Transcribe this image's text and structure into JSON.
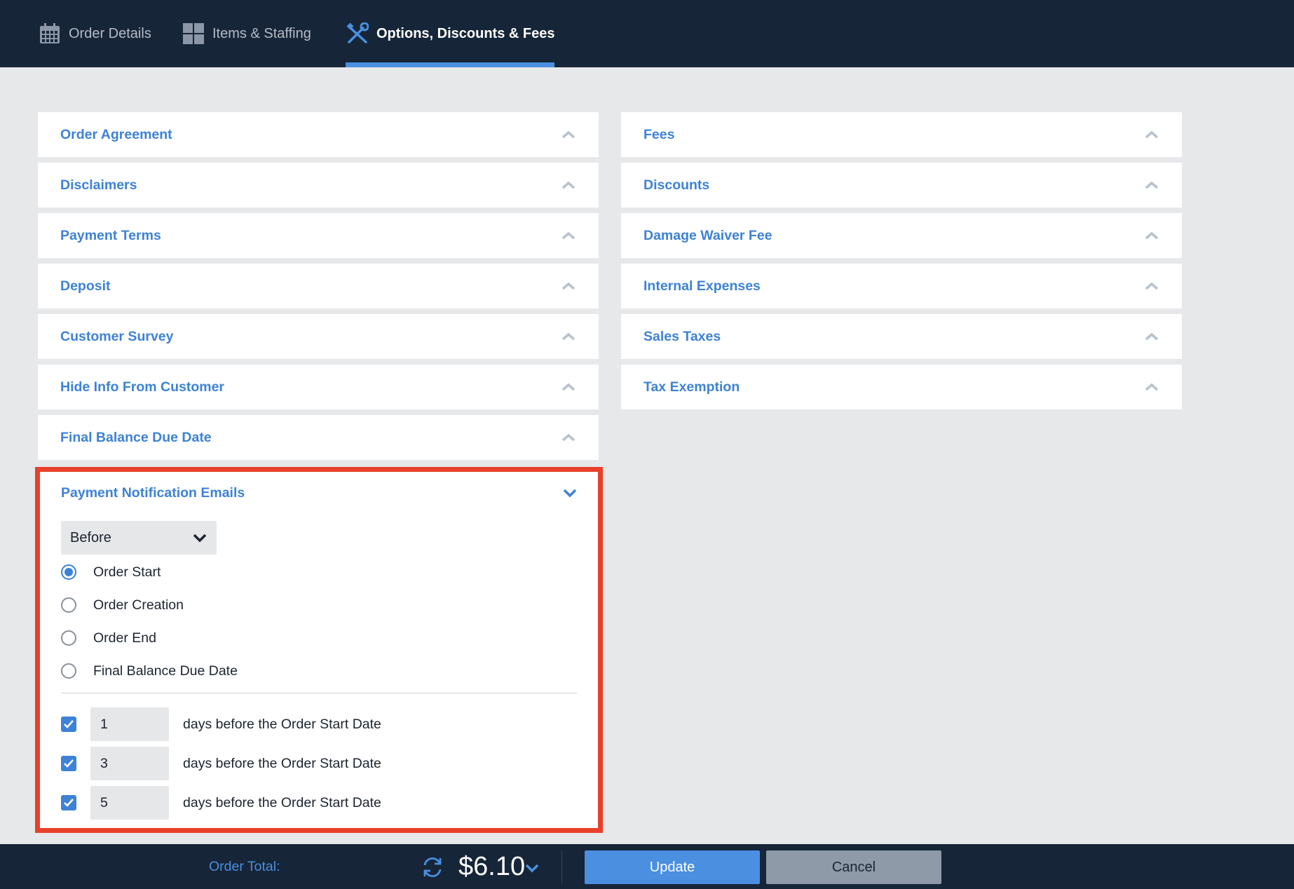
{
  "tabs": [
    {
      "label": "Order Details",
      "icon": "calendar-icon",
      "active": false
    },
    {
      "label": "Items & Staffing",
      "icon": "grid-icon",
      "active": false
    },
    {
      "label": "Options, Discounts & Fees",
      "icon": "tools-icon",
      "active": true
    }
  ],
  "left_panels": [
    {
      "title": "Order Agreement"
    },
    {
      "title": "Disclaimers"
    },
    {
      "title": "Payment Terms"
    },
    {
      "title": "Deposit"
    },
    {
      "title": "Customer Survey"
    },
    {
      "title": "Hide Info From Customer"
    },
    {
      "title": "Final Balance Due Date"
    }
  ],
  "right_panels": [
    {
      "title": "Fees"
    },
    {
      "title": "Discounts"
    },
    {
      "title": "Damage Waiver Fee"
    },
    {
      "title": "Internal Expenses"
    },
    {
      "title": "Sales Taxes"
    },
    {
      "title": "Tax Exemption"
    }
  ],
  "notifications": {
    "title": "Payment Notification Emails",
    "timing_select": "Before",
    "reference_options": [
      {
        "label": "Order Start",
        "selected": true
      },
      {
        "label": "Order Creation",
        "selected": false
      },
      {
        "label": "Order End",
        "selected": false
      },
      {
        "label": "Final Balance Due Date",
        "selected": false
      }
    ],
    "reminders": [
      {
        "checked": true,
        "days": "1",
        "text": "days before the Order Start Date"
      },
      {
        "checked": true,
        "days": "3",
        "text": "days before the Order Start Date"
      },
      {
        "checked": true,
        "days": "5",
        "text": "days before the Order Start Date"
      }
    ]
  },
  "footer": {
    "total_label": "Order Total:",
    "amount": "$6.10",
    "update_label": "Update",
    "cancel_label": "Cancel"
  },
  "colors": {
    "nav_bg": "#162538",
    "accent": "#4a8fe0",
    "panel_title": "#3d82d6",
    "highlight_border": "#e8402a"
  }
}
